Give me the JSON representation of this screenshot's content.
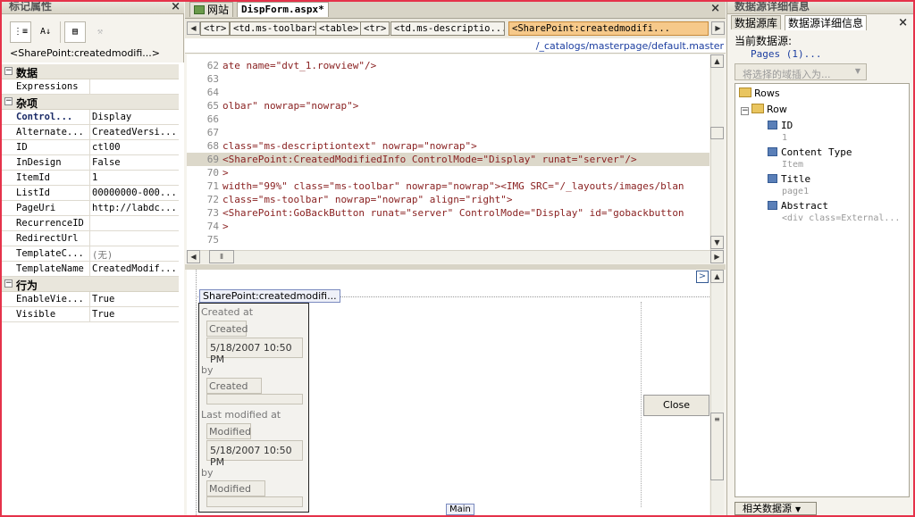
{
  "left_panel": {
    "title": "标记属性",
    "tag_label": "<SharePoint:createdmodifi...>",
    "toolbar": [
      "categorized-icon",
      "sort-az-icon",
      "show-set-properties-icon",
      "tag-props-icon"
    ],
    "categories": [
      {
        "name": "数据",
        "rows": [
          {
            "key": "Expressions",
            "value": ""
          }
        ]
      },
      {
        "name": "杂项",
        "rows": [
          {
            "key": "Control...",
            "value": "Display"
          },
          {
            "key": "Alternate...",
            "value": "CreatedVersi..."
          },
          {
            "key": "ID",
            "value": "ctl00"
          },
          {
            "key": "InDesign",
            "value": "False"
          },
          {
            "key": "ItemId",
            "value": "1"
          },
          {
            "key": "ListId",
            "value": "00000000-000..."
          },
          {
            "key": "PageUri",
            "value": "http://labdc..."
          },
          {
            "key": "RecurrenceID",
            "value": ""
          },
          {
            "key": "RedirectUrl",
            "value": ""
          },
          {
            "key": "TemplateC...",
            "value": "(无)"
          },
          {
            "key": "TemplateName",
            "value": "CreatedModif..."
          }
        ]
      },
      {
        "name": "行为",
        "rows": [
          {
            "key": "EnableVie...",
            "value": "True"
          },
          {
            "key": "Visible",
            "value": "True"
          }
        ]
      }
    ]
  },
  "editor": {
    "tabs": [
      {
        "label": "网站",
        "active": false
      },
      {
        "label": "DispForm.aspx*",
        "active": true
      }
    ],
    "breadcrumbs": [
      "<tr>",
      "<td.ms-toolbar>",
      "<table>",
      "<tr>",
      "<td.ms-descriptio...>",
      "<SharePoint:createdmodifi..."
    ],
    "path": "/_catalogs/masterpage/default.master",
    "code_lines": [
      {
        "n": "62",
        "t": "ate name=\"dvt_1.rowview\"/>"
      },
      {
        "n": "63",
        "t": ""
      },
      {
        "n": "64",
        "t": ""
      },
      {
        "n": "65",
        "t": "olbar\" nowrap=\"nowrap\">"
      },
      {
        "n": "66",
        "t": ""
      },
      {
        "n": "67",
        "t": ""
      },
      {
        "n": "68",
        "t": "class=\"ms-descriptiontext\" nowrap=\"nowrap\">"
      },
      {
        "n": "69",
        "t": "<SharePoint:CreatedModifiedInfo ControlMode=\"Display\" runat=\"server\"/>"
      },
      {
        "n": "70",
        "t": ">"
      },
      {
        "n": "71",
        "t": "width=\"99%\" class=\"ms-toolbar\" nowrap=\"nowrap\"><IMG SRC=\"/_layouts/images/blan"
      },
      {
        "n": "72",
        "t": "class=\"ms-toolbar\" nowrap=\"nowrap\" align=\"right\">"
      },
      {
        "n": "73",
        "t": "<SharePoint:GoBackButton runat=\"server\" ControlMode=\"Display\" id=\"gobackbutton"
      },
      {
        "n": "74",
        "t": ">"
      },
      {
        "n": "75",
        "t": ""
      }
    ]
  },
  "design": {
    "control_tag": "SharePoint:createdmodifi...",
    "created_at_label": "Created at",
    "created_field": "Created",
    "created_value": "5/18/2007 10:50 PM",
    "by_label_1": "by",
    "created_by_field": "Created By",
    "last_modified_label": "Last modified at",
    "modified_field": "Modified",
    "modified_value": "5/18/2007 10:50 PM",
    "by_label_2": "by",
    "modified_by_field": "Modified By",
    "close_button": "Close",
    "main_label": "Main"
  },
  "right_panel": {
    "title": "数据源详细信息",
    "tabs": [
      {
        "label": "数据源库",
        "active": false
      },
      {
        "label": "数据源详细信息",
        "active": true
      }
    ],
    "current_source_label": "当前数据源:",
    "current_source_value": "Pages (1)...",
    "insert_button": "将选择的域插入为...",
    "tree": {
      "root": "Rows",
      "row": "Row",
      "fields": [
        {
          "name": "ID",
          "value": "1"
        },
        {
          "name": "Content Type",
          "value": "Item"
        },
        {
          "name": "Title",
          "value": "page1"
        },
        {
          "name": "Abstract",
          "value": "<div class=External..."
        }
      ]
    },
    "related_button": "相关数据源"
  }
}
